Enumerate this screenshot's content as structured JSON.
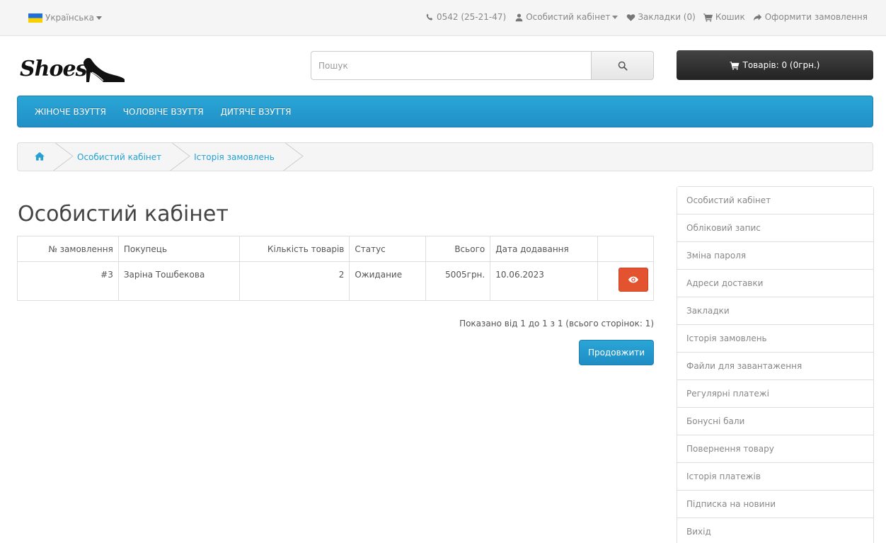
{
  "topbar": {
    "language": "Українська",
    "phone": "0542 (25-21-47)",
    "account": "Особистий кабінет",
    "wishlist": "Закладки (0)",
    "cart": "Кошик",
    "checkout": "Оформити замовлення"
  },
  "header": {
    "logo_text": "Shoes",
    "search_placeholder": "Пошук",
    "cart_button": "Товарів: 0 (0грн.)"
  },
  "menu": {
    "items": [
      "ЖІНОЧЕ ВЗУТТЯ",
      "ЧОЛОВІЧЕ ВЗУТТЯ",
      "ДИТЯЧЕ ВЗУТТЯ"
    ]
  },
  "breadcrumb": {
    "items": [
      "Особистий кабінет",
      "Історія замовлень"
    ]
  },
  "main": {
    "title": "Особистий кабінет",
    "table": {
      "headers": [
        "№ замовлення",
        "Покупець",
        "Кількість товарів",
        "Статус",
        "Всього",
        "Дата додавання",
        ""
      ],
      "rows": [
        {
          "order_id": "#3",
          "customer": "Заріна Тошбекова",
          "qty": "2",
          "status": "Ожидание",
          "total": "5005грн.",
          "date": "10.06.2023"
        }
      ]
    },
    "pagination": "Показано від 1 до 1 з 1 (всього сторінок: 1)",
    "continue_button": "Продовжити"
  },
  "sidebar": {
    "items": [
      "Особистий кабінет",
      "Обліковий запис",
      "Зміна пароля",
      "Адреси доставки",
      "Закладки",
      "Історія замовлень",
      "Файли для завантаження",
      "Регулярні платежі",
      "Бонусні бали",
      "Повернення товару",
      "Історія платежів",
      "Підписка на новини",
      "Вихід"
    ]
  },
  "colors": {
    "menu_blue": "#2aa5d6",
    "link_blue": "#23a1d1",
    "view_button": "#e4532f",
    "cart_button": "#333333"
  }
}
